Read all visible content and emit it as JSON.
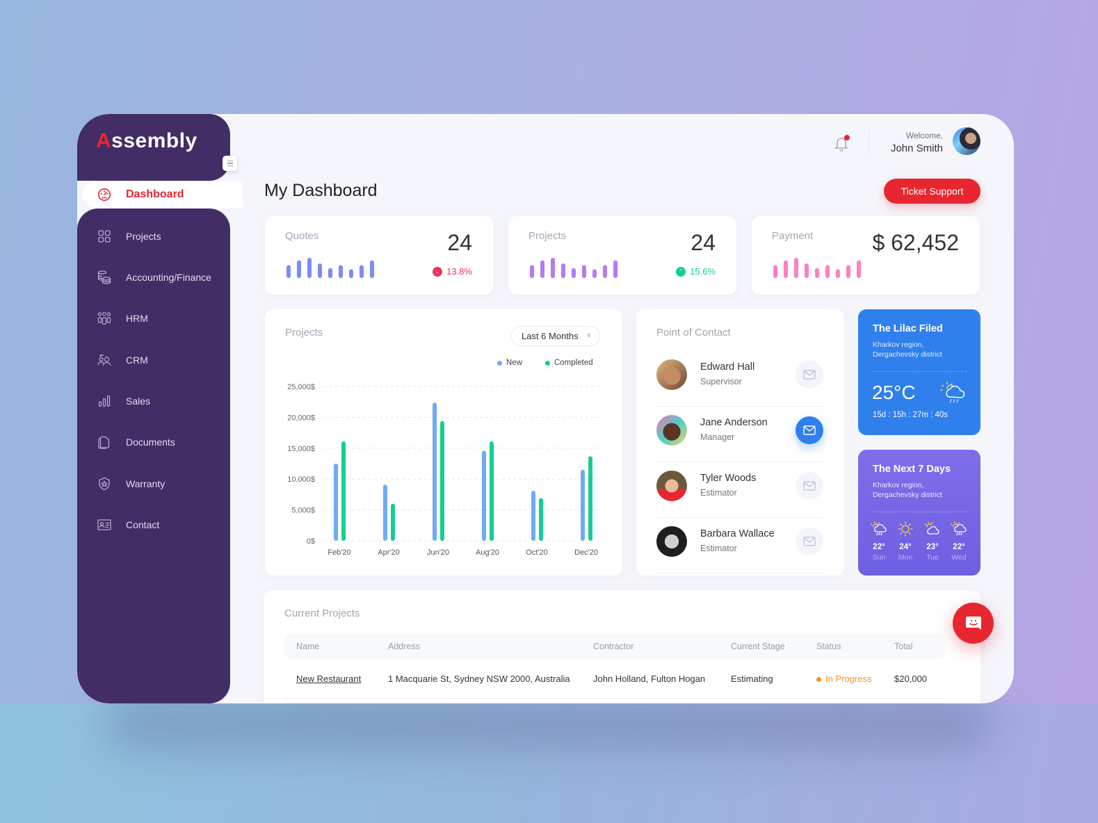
{
  "app": {
    "logo_first": "A",
    "logo_rest": "ssembly"
  },
  "sidebar": {
    "items": [
      {
        "label": "Dashboard",
        "icon": "speedometer-icon",
        "active": true
      },
      {
        "label": "Projects",
        "icon": "grid-icon"
      },
      {
        "label": "Accounting/Finance",
        "icon": "coins-stack-icon"
      },
      {
        "label": "HRM",
        "icon": "people-group-icon"
      },
      {
        "label": "CRM",
        "icon": "customers-icon"
      },
      {
        "label": "Sales",
        "icon": "bar-chart-icon"
      },
      {
        "label": "Documents",
        "icon": "documents-icon"
      },
      {
        "label": "Warranty",
        "icon": "shield-star-icon"
      },
      {
        "label": "Contact",
        "icon": "contact-card-icon"
      }
    ]
  },
  "header": {
    "welcome": "Welcome,",
    "user_name": "John Smith",
    "notification_icon": "bell-icon"
  },
  "page": {
    "title": "My Dashboard",
    "ticket_button": "Ticket Support"
  },
  "colors": {
    "brand_red": "#e8262f",
    "sidebar": "#422d66",
    "new_series": "#6eaaf7",
    "completed_series": "#13cf93",
    "quotes_spark": "#7b8cf7",
    "projects_spark": "#b57af5",
    "payment_spark": "#ff7fc3",
    "weather_blue": "#2f80ed",
    "weather_purple": "#7466e6",
    "status_orange": "#f7931e"
  },
  "stats": [
    {
      "label": "Quotes",
      "value": "24",
      "delta": "13.8%",
      "trend": "down",
      "spark": [
        0.62,
        0.85,
        0.97,
        0.7,
        0.48,
        0.62,
        0.42,
        0.62,
        0.85
      ]
    },
    {
      "label": "Projects",
      "value": "24",
      "delta": "15.6%",
      "trend": "up",
      "spark": [
        0.62,
        0.85,
        0.97,
        0.7,
        0.48,
        0.62,
        0.42,
        0.62,
        0.85
      ]
    },
    {
      "label": "Payment",
      "value": "$ 62,452",
      "delta": "",
      "trend": "",
      "spark": [
        0.62,
        0.85,
        0.97,
        0.7,
        0.48,
        0.62,
        0.42,
        0.62,
        0.85
      ]
    }
  ],
  "projects_chart": {
    "title": "Projects",
    "range_select": "Last 6 Months",
    "legend_new": "New",
    "legend_completed": "Completed"
  },
  "chart_data": {
    "type": "bar",
    "title": "Projects",
    "xlabel": "",
    "ylabel": "",
    "categories": [
      "Feb'20",
      "Apr'20",
      "Jun'20",
      "Aug'20",
      "Oct'20",
      "Dec'20"
    ],
    "series": [
      {
        "name": "New",
        "values": [
          12500,
          9100,
          22400,
          14600,
          8100,
          11500
        ]
      },
      {
        "name": "Completed",
        "values": [
          16100,
          6000,
          19400,
          16100,
          6900,
          13700
        ]
      }
    ],
    "ylim": [
      0,
      25000
    ],
    "yticks": [
      "0$",
      "5,000$",
      "10,000$",
      "15,000$",
      "20,000$",
      "25,000$"
    ],
    "grid": true,
    "legend": "top-right"
  },
  "contacts": {
    "title": "Point of Contact",
    "items": [
      {
        "name": "Edward Hall",
        "role": "Supervisor",
        "active": false
      },
      {
        "name": "Jane Anderson",
        "role": "Manager",
        "active": true
      },
      {
        "name": "Tyler Woods",
        "role": "Estimator",
        "active": false
      },
      {
        "name": "Barbara Wallace",
        "role": "Estimator",
        "active": false
      }
    ]
  },
  "weather_now": {
    "title": "The Lilac Filed",
    "region_line1": "Kharkov region,",
    "region_line2": "Dergachevsky district",
    "temp": "25°C",
    "countdown": "15d : 15h :  27m : 40s",
    "icon": "sun-cloud-rain-icon"
  },
  "weather_week": {
    "title": "The Next 7 Days",
    "region_line1": "Kharkov region,",
    "region_line2": "Dergachevsky district",
    "days": [
      {
        "day": "Sun",
        "temp": "22°",
        "icon": "sun-cloud-rain-icon"
      },
      {
        "day": "Mon",
        "temp": "24°",
        "icon": "sun-icon"
      },
      {
        "day": "Tue",
        "temp": "23°",
        "icon": "sun-cloud-icon"
      },
      {
        "day": "Wed",
        "temp": "22°",
        "icon": "sun-cloud-rain-icon"
      }
    ]
  },
  "current_projects": {
    "title": "Current Projects",
    "columns": [
      "Name",
      "Address",
      "Contractor",
      "Current Stage",
      "Status",
      "Total"
    ],
    "rows": [
      {
        "name": "New Restaurant",
        "address": "1 Macquarie St, Sydney NSW 2000, Australia",
        "contractor": "John Holland, Fulton Hogan",
        "stage": "Estimating",
        "status": "In Progress",
        "total": "$20,000"
      }
    ]
  }
}
